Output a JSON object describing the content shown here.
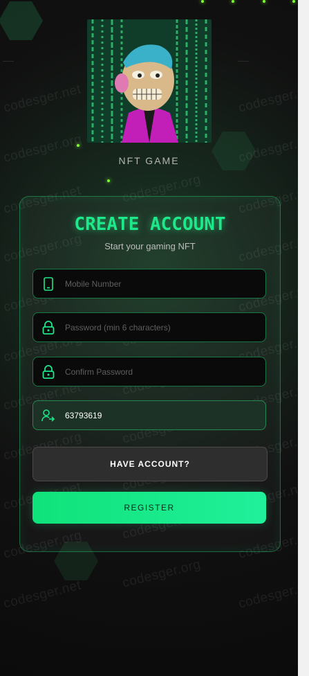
{
  "header": {
    "nft_title": "NFT GAME"
  },
  "card": {
    "title": "CREATE ACCOUNT",
    "subtitle": "Start your gaming NFT"
  },
  "form": {
    "mobile": {
      "placeholder": "Mobile Number",
      "value": ""
    },
    "password": {
      "placeholder": "Password (min 6 characters)",
      "value": ""
    },
    "confirm": {
      "placeholder": "Confirm Password",
      "value": ""
    },
    "referral": {
      "placeholder": "",
      "value": "63793619"
    }
  },
  "buttons": {
    "have_account": "HAVE ACCOUNT?",
    "register": "REGISTER"
  },
  "watermark": {
    "net": "codesger.net",
    "org": "codesger.org"
  },
  "colors": {
    "accent": "#1de88a",
    "register_button": "#10e27a"
  },
  "icons": {
    "mobile": "phone-icon",
    "password": "lock-icon",
    "confirm": "lock-icon",
    "referral": "user-share-icon"
  }
}
